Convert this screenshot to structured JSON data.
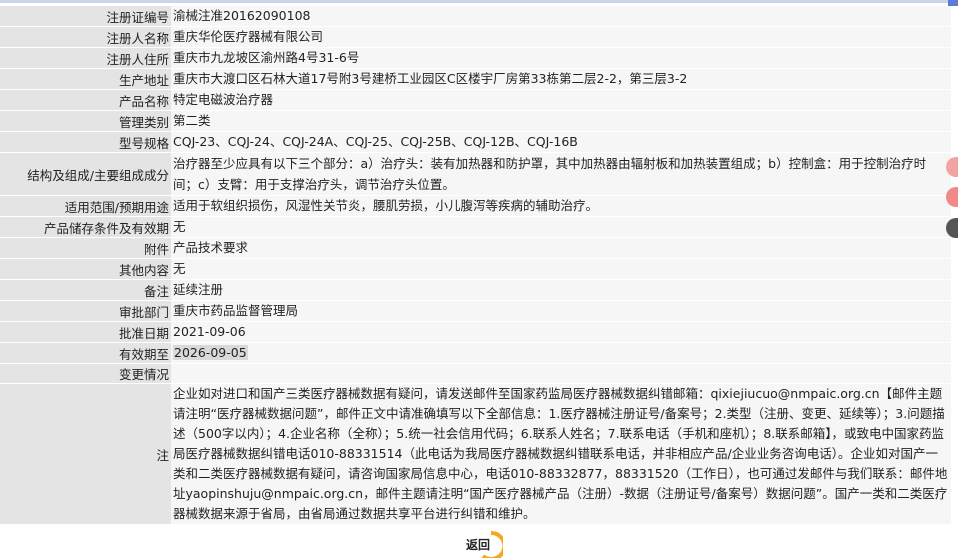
{
  "rows": [
    {
      "label": "注册证编号",
      "value": "渝械注准20162090108"
    },
    {
      "label": "注册人名称",
      "value": "重庆华伦医疗器械有限公司"
    },
    {
      "label": "注册人住所",
      "value": "重庆市九龙坡区渝州路4号31-6号"
    },
    {
      "label": "生产地址",
      "value": "重庆市大渡口区石林大道17号附3号建桥工业园区C区楼宇厂房第33栋第二层2-2，第三层3-2"
    },
    {
      "label": "产品名称",
      "value": "特定电磁波治疗器"
    },
    {
      "label": "管理类别",
      "value": "第二类"
    },
    {
      "label": "型号规格",
      "value": "CQJ-23、CQJ-24、CQJ-24A、CQJ-25、CQJ-25B、CQJ-12B、CQJ-16B"
    },
    {
      "label": "结构及组成/主要组成成分",
      "value": "治疗器至少应具有以下三个部分：a）治疗头：装有加热器和防护罩，其中加热器由辐射板和加热装置组成；b）控制盒：用于控制治疗时间；c）支臂：用于支撑治疗头，调节治疗头位置。"
    },
    {
      "label": "适用范围/预期用途",
      "value": "适用于软组织损伤，风湿性关节炎，腰肌劳损，小儿腹泻等疾病的辅助治疗。"
    },
    {
      "label": "产品储存条件及有效期",
      "value": "无"
    },
    {
      "label": "附件",
      "value": "产品技术要求"
    },
    {
      "label": "其他内容",
      "value": "无"
    },
    {
      "label": "备注",
      "value": "延续注册"
    },
    {
      "label": "审批部门",
      "value": "重庆市药品监督管理局"
    },
    {
      "label": "批准日期",
      "value": "2021-09-06"
    },
    {
      "label": "有效期至",
      "value": "2026-09-05"
    },
    {
      "label": "变更情况",
      "value": ""
    }
  ],
  "note": {
    "label": "注",
    "text": "企业如对进口和国产三类医疗器械数据有疑问，请发送邮件至国家药监局医疗器械数据纠错邮箱：qixiejiucuo@nmpaic.org.cn【邮件主题请注明“医疗器械数据问题”，邮件正文中请准确填写以下全部信息：1.医疗器械注册证号/备案号；2.类型（注册、变更、延续等）；3.问题描述（500字以内）；4.企业名称（全称）；5.统一社会信用代码；6.联系人姓名；7.联系电话（手机和座机）；8.联系邮箱】，或致电中国家药监局医疗器械数据纠错电话010-88331514（此电话为我局医疗器械数据纠错联系电话，并非相应产品/企业业务咨询电话）。企业如对国产一类和二类医疗器械数据有疑问，请咨询国家局信息中心，电话010-88332877，88331520（工作日），也可通过发邮件与我们联系：邮件地址yaopinshuju@nmpaic.org.cn，邮件主题请注明“国产医疗器械产品（注册）-数据（注册证号/备案号）数据问题”。国产一类和二类医疗器械数据来源于省局，由省局通过数据共享平台进行纠错和维护。"
  },
  "return_label": "返回",
  "colors": {
    "label_bg": "#e4e4e4",
    "value_bg": "#f6f6f6",
    "accent": "#f5a623",
    "side_icon": "#f08a8a"
  }
}
